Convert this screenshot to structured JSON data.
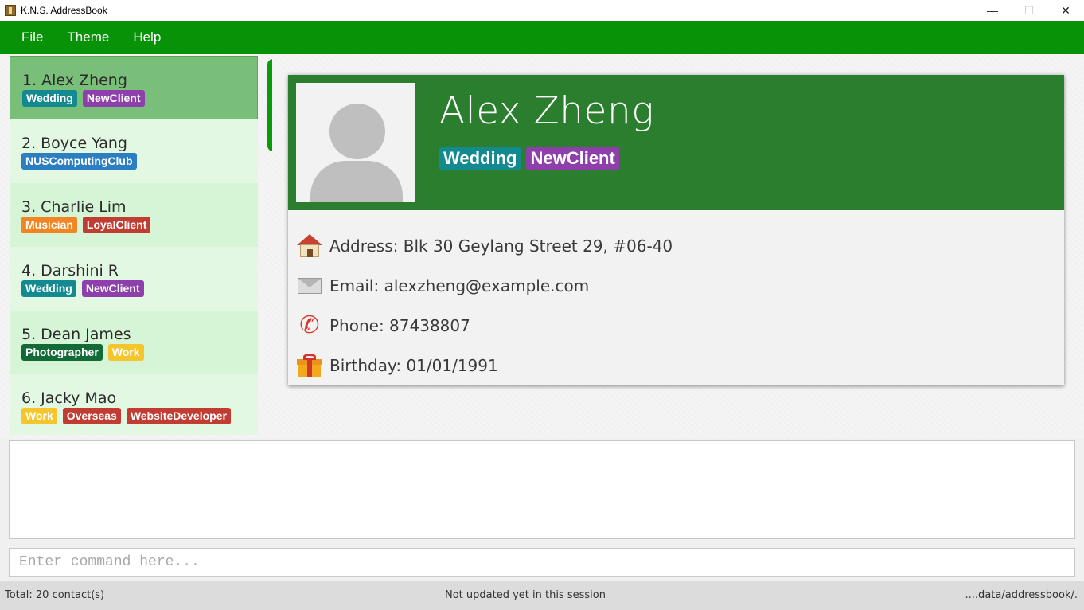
{
  "window": {
    "title": "K.N.S. AddressBook",
    "controls": [
      "—",
      "☐",
      "✕"
    ]
  },
  "menu": [
    "File",
    "Theme",
    "Help"
  ],
  "colors": {
    "accent": "#079207",
    "header": "#2b7e2e",
    "selected_card": "#79be79"
  },
  "tag_colors": {
    "Wedding": "#138a8f",
    "NewClient": "#8e3fab",
    "NUSComputingClub": "#2a7ec1",
    "Musician": "#f08522",
    "LoyalClient": "#c13c31",
    "Photographer": "#126a37",
    "Work": "#f5c52b",
    "Overseas": "#c13c31",
    "WebsiteDeveloper": "#c13c31"
  },
  "persons": [
    {
      "index": "1.",
      "name": "Alex Zheng",
      "tags": [
        "Wedding",
        "NewClient"
      ],
      "selected": true
    },
    {
      "index": "2.",
      "name": "Boyce Yang",
      "tags": [
        "NUSComputingClub"
      ]
    },
    {
      "index": "3.",
      "name": "Charlie Lim",
      "tags": [
        "Musician",
        "LoyalClient"
      ]
    },
    {
      "index": "4.",
      "name": "Darshini R",
      "tags": [
        "Wedding",
        "NewClient"
      ]
    },
    {
      "index": "5.",
      "name": "Dean James",
      "tags": [
        "Photographer",
        "Work"
      ]
    },
    {
      "index": "6.",
      "name": "Jacky Mao",
      "tags": [
        "Work",
        "Overseas",
        "WebsiteDeveloper"
      ]
    }
  ],
  "detail": {
    "name": "Alex Zheng",
    "tags": [
      "Wedding",
      "NewClient"
    ],
    "address": "Address: Blk 30 Geylang Street 29, #06-40",
    "email": "Email: alexzheng@example.com",
    "phone": "Phone: 87438807",
    "birthday": "Birthday: 01/01/1991",
    "icons": {
      "address": "house-icon",
      "email": "mail-icon",
      "phone": "phone-icon",
      "birthday": "gift-icon"
    }
  },
  "result": "",
  "command": {
    "value": "",
    "placeholder": "Enter command here..."
  },
  "status": {
    "left": "Total: 20 contact(s)",
    "center": "Not updated yet in this session",
    "right": "....data/addressbook/."
  }
}
